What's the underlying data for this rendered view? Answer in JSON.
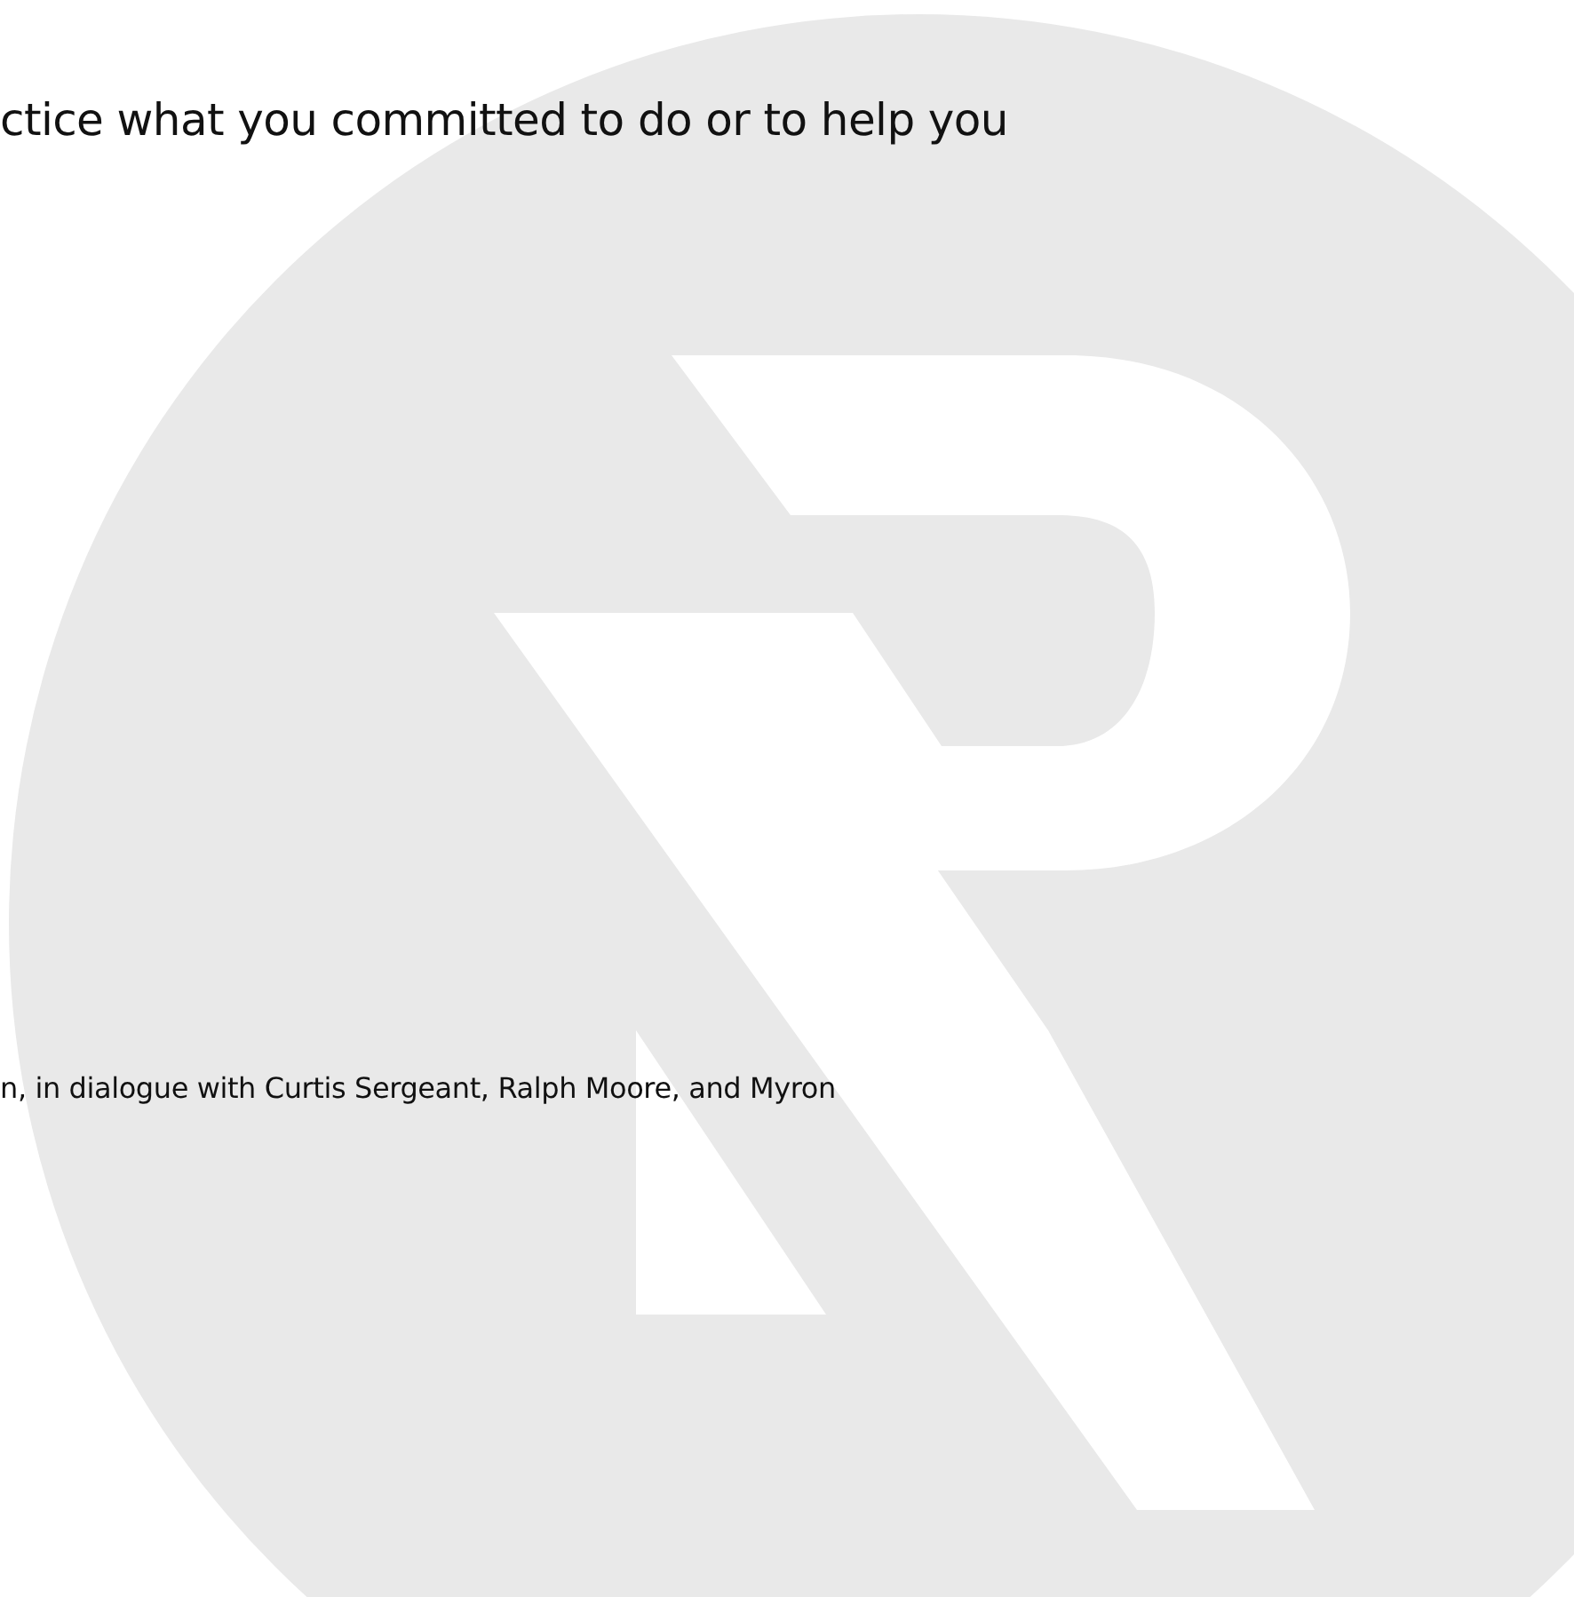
{
  "intro_text": "ctice what you committed to do or to help you",
  "credit_text": "n, in dialogue with Curtis Sergeant, Ralph Moore, and Myron"
}
